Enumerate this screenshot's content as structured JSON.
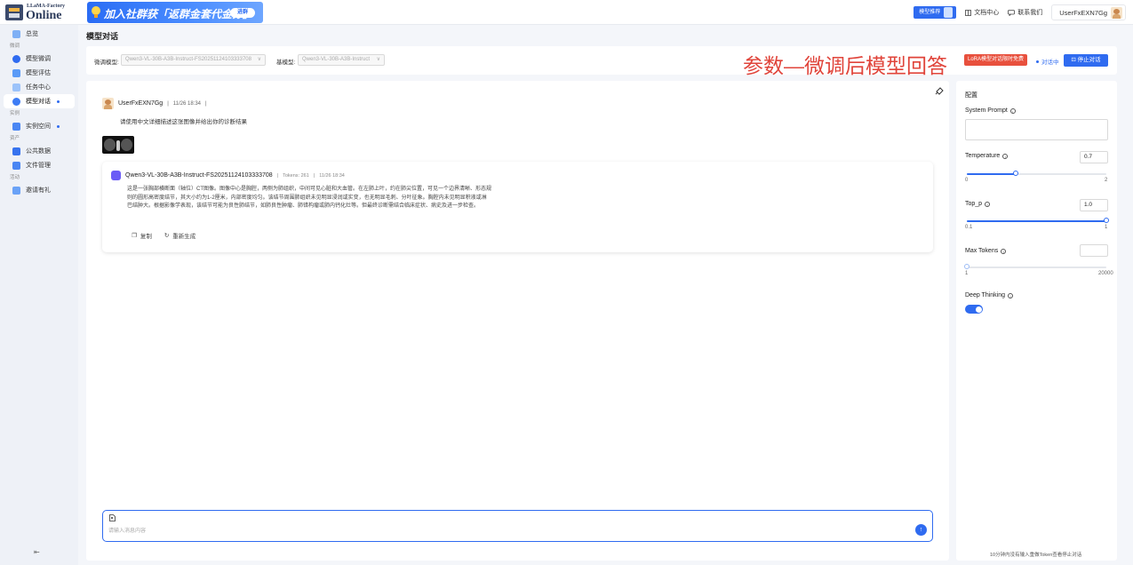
{
  "header": {
    "logo_small": "LLaMA-Factory",
    "logo_big": "Online",
    "banner_text": "加入社群获「返群金套代金券」",
    "banner_button": "进群",
    "recommend_label": "模型推荐",
    "docs_label": "文档中心",
    "contact_label": "联系我们",
    "username": "UserFxEXN7Gg"
  },
  "sidebar": {
    "items": [
      {
        "label": "总览",
        "icon": "overview-icon"
      },
      {
        "section": "微调"
      },
      {
        "label": "模型微调",
        "icon": "finetune-icon"
      },
      {
        "label": "模型评估",
        "icon": "evaluate-icon"
      },
      {
        "label": "任务中心",
        "icon": "task-icon"
      },
      {
        "label": "模型对话",
        "icon": "chat-icon",
        "active": true,
        "dot": true
      },
      {
        "section": "实例"
      },
      {
        "label": "实例空间",
        "icon": "instance-icon",
        "dot": true
      },
      {
        "section": "资产"
      },
      {
        "label": "公共数据",
        "icon": "dataset-icon"
      },
      {
        "label": "文件管理",
        "icon": "file-icon"
      },
      {
        "section": "活动"
      },
      {
        "label": "邀请有礼",
        "icon": "gift-icon"
      }
    ],
    "collapse_glyph": "⇤"
  },
  "page": {
    "title": "模型对话",
    "finetuned_label": "微调模型:",
    "finetuned_value": "Qwen3-VL-30B-A3B-Instruct-FS20251124103333708",
    "base_label": "基模型:",
    "base_value": "Qwen3-VL-30B-A3B-Instruct",
    "annotation": "参数—微调后模型回答",
    "lora_badge": "LoRA模型对话限时免费",
    "status": "对话中",
    "stop_button": "停止对话"
  },
  "chat": {
    "user_name": "UserFxEXN7Gg",
    "user_time": "11/26 18:34",
    "user_message": "请使用中文详细描述这张图像并给出你的诊断结果",
    "bot_name": "Qwen3-VL-30B-A3B-Instruct-FS20251124103333708",
    "bot_tokens": "Tokens: 261",
    "bot_time": "11/26 18:34",
    "bot_reply": "这是一张胸部横断面（轴位）CT图像。图像中心是胸腔，两侧为肺组织，中间可见心脏和大血管。在左肺上叶，约在肺尖位置，可见一个边界清晰、形态规则的圆形高密度结节，其大小约为1-2厘米，内部密度均匀。该结节周围肺组织未见明显浸润或实变，也无明显毛刺、分叶征象。胸腔内未见明显积液或淋巴结肿大。根据影像学表现，该结节可能为良性肺结节，如肺良性肿瘤、肺错构瘤或肺内钙化灶等。但最终诊断需结合临床症状、病史及进一步检查。",
    "copy_label": "复制",
    "regenerate_label": "重新生成",
    "input_placeholder": "请输入消息内容"
  },
  "config": {
    "title": "配置",
    "system_prompt_label": "System Prompt",
    "temperature_label": "Temperature",
    "temperature_value": "0.7",
    "temperature_min": "0",
    "temperature_max": "2",
    "top_p_label": "Top_p",
    "top_p_value": "1.0",
    "top_p_min": "0.1",
    "top_p_max": "1",
    "max_tokens_label": "Max Tokens",
    "max_tokens_value": "",
    "max_tokens_min": "1",
    "max_tokens_max": "20000",
    "deep_thinking_label": "Deep Thinking",
    "deep_thinking_on": true,
    "footer_note": "10分钟内没有输入重做Token查看停止对话"
  },
  "levels": {
    "temperature_fraction": 0.35,
    "top_p_fraction": 1.0,
    "max_tokens_fraction": 0.0
  },
  "colors": {
    "accent": "#2f6bf0",
    "annotation": "#e0443a",
    "lora_badge": "#e8503d"
  }
}
